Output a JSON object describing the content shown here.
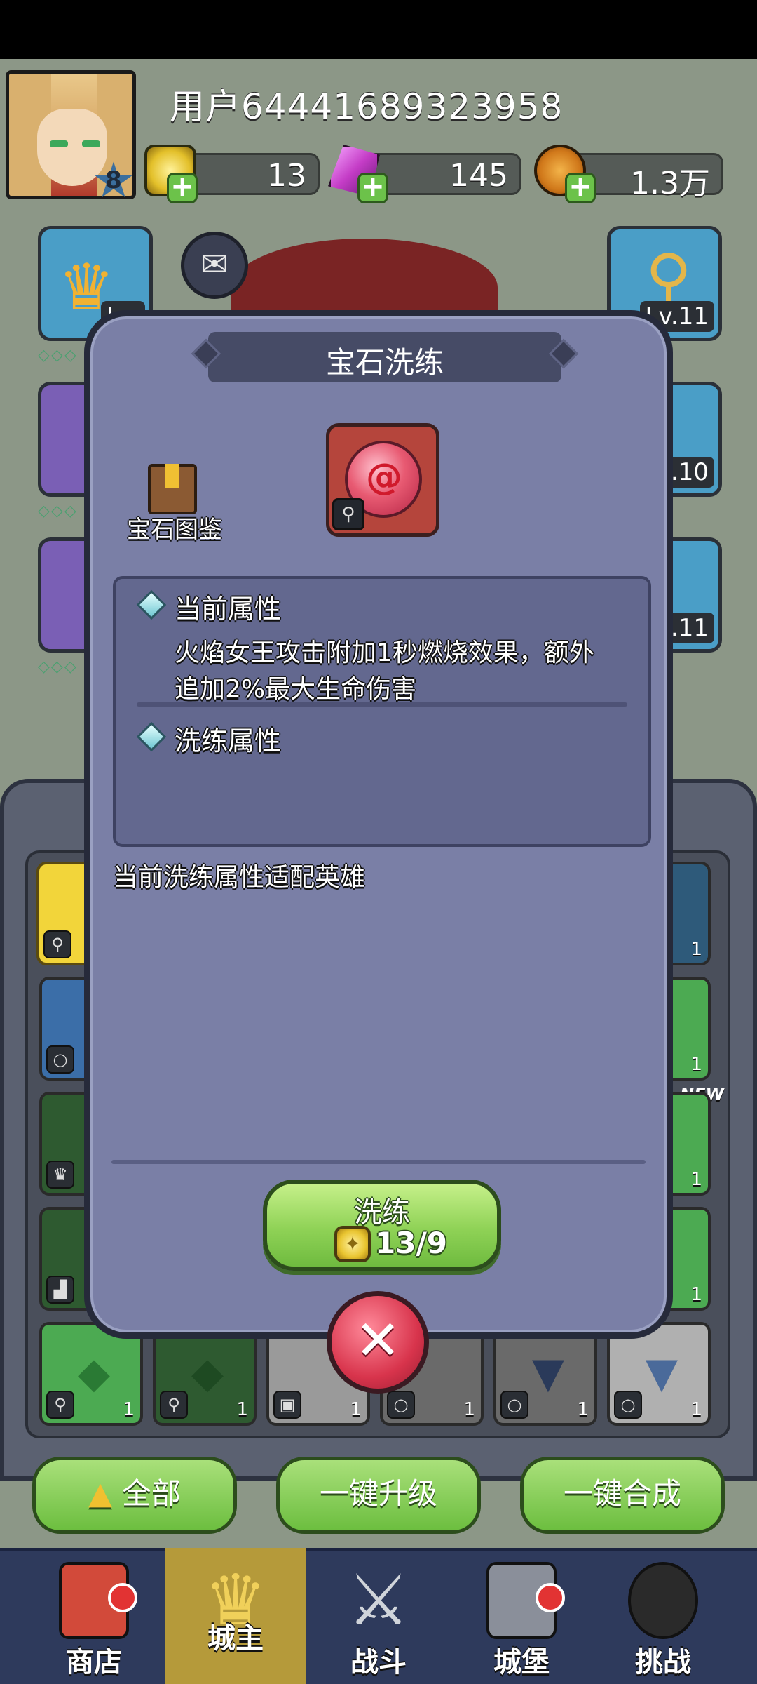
{
  "header": {
    "username": "用户64441689323958",
    "player_level": "8",
    "resources": [
      {
        "name": "gold-gem-currency",
        "value": "13"
      },
      {
        "name": "pink-crystal-currency",
        "value": "145"
      },
      {
        "name": "copper-coin-currency",
        "value": "1.3万"
      }
    ]
  },
  "side_tiles": {
    "left_top_level": "Lv.",
    "right_top_level": "Lv.11",
    "right_mid_level": ".10",
    "right_low_level": "v.11"
  },
  "modal": {
    "title": "宝石洗练",
    "book_label": "宝石图鉴",
    "current_attr_heading": "当前属性",
    "current_attr_text_line1": "火焰女王攻击附加1秒燃烧效果，额外",
    "current_attr_text_line2": "追加2%最大生命伤害",
    "refine_attr_heading": "洗练属性",
    "hero_note": "当前洗练属性适配英雄",
    "refine_button_label": "洗练",
    "refine_cost": "13/9"
  },
  "inventory": {
    "slot_counts": [
      "1",
      "1",
      "1",
      "1",
      "1",
      "1",
      "1",
      "1",
      "1",
      "1"
    ],
    "new_label": "NEW"
  },
  "bottom_buttons": {
    "all": "全部",
    "upgrade_all": "一键升级",
    "merge_all": "一键合成"
  },
  "nav": [
    {
      "label": "商店"
    },
    {
      "label": "城主"
    },
    {
      "label": "战斗"
    },
    {
      "label": "城堡"
    },
    {
      "label": "挑战"
    }
  ],
  "colors": {
    "modal_bg": "#7a7fa6",
    "button_green": "#8fd256",
    "close_red": "#d8344c",
    "nav_bg": "#2e3a5c",
    "nav_active": "#b59a3a"
  }
}
